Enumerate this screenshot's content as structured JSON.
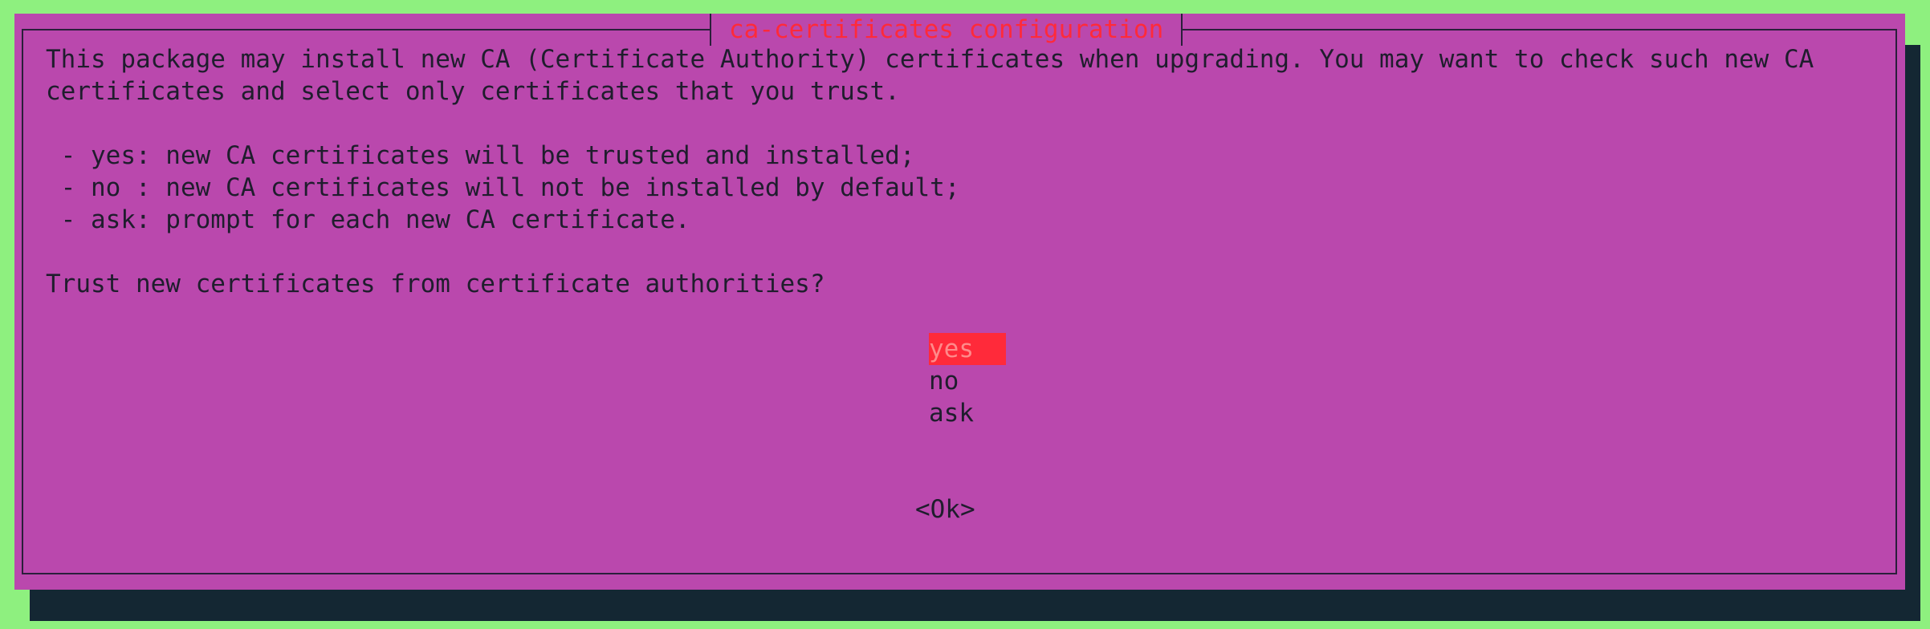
{
  "dialog": {
    "title": "ca-certificates configuration",
    "description_line1": "This package may install new CA (Certificate Authority) certificates when upgrading. You may want to check such new CA",
    "description_line2": "certificates and select only certificates that you trust.",
    "option_yes_desc": " - yes: new CA certificates will be trusted and installed;",
    "option_no_desc": " - no : new CA certificates will not be installed by default;",
    "option_ask_desc": " - ask: prompt for each new CA certificate.",
    "question": "Trust new certificates from certificate authorities?",
    "choices": [
      {
        "label": "yes",
        "selected": true
      },
      {
        "label": "no",
        "selected": false
      },
      {
        "label": "ask",
        "selected": false
      }
    ],
    "ok_button": "<Ok>"
  },
  "colors": {
    "background": "#8ef07f",
    "dialog": "#ba48ad",
    "shadow": "#142733",
    "accent": "#ff2a3a",
    "text": "#1f1d2d"
  }
}
